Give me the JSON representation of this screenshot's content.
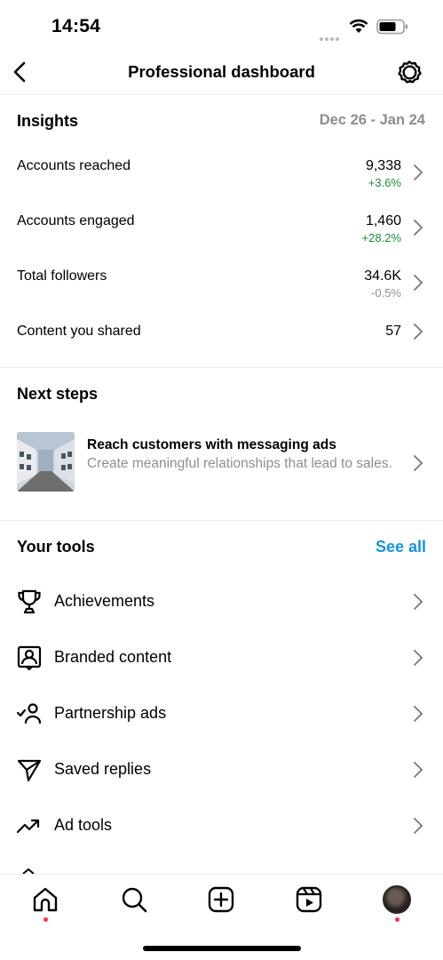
{
  "status_bar": {
    "time": "14:54"
  },
  "header": {
    "title": "Professional dashboard"
  },
  "insights": {
    "title": "Insights",
    "date_range": "Dec 26 - Jan 24",
    "metrics": [
      {
        "label": "Accounts reached",
        "value": "9,338",
        "change": "+3.6%"
      },
      {
        "label": "Accounts engaged",
        "value": "1,460",
        "change": "+28.2%"
      },
      {
        "label": "Total followers",
        "value": "34.6K",
        "change": "-0.5%"
      },
      {
        "label": "Content you shared",
        "value": "57",
        "change": ""
      }
    ]
  },
  "next_steps": {
    "title": "Next steps",
    "card": {
      "title": "Reach customers with messaging ads",
      "description": "Create meaningful relationships that lead to sales."
    }
  },
  "tools": {
    "title": "Your tools",
    "see_all": "See all",
    "items": [
      {
        "label": "Achievements",
        "icon": "trophy-icon"
      },
      {
        "label": "Branded content",
        "icon": "branded-content-icon"
      },
      {
        "label": "Partnership ads",
        "icon": "partnership-icon"
      },
      {
        "label": "Saved replies",
        "icon": "send-icon"
      },
      {
        "label": "Ad tools",
        "icon": "trending-up-icon"
      }
    ]
  },
  "bottom_nav": {
    "items": [
      "home-icon",
      "search-icon",
      "create-icon",
      "reels-icon",
      "profile-avatar"
    ]
  },
  "colors": {
    "accent": "#1592e6",
    "positive": "#1e8a35",
    "muted": "#8e8e8e",
    "notification": "#ff3040"
  }
}
